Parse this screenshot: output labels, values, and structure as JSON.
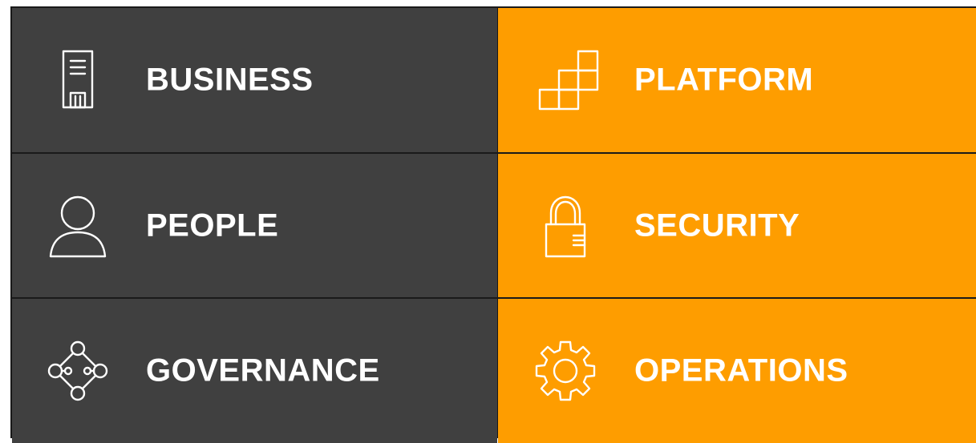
{
  "colors": {
    "dark_tile": "#404040",
    "accent_tile": "#fe9d00",
    "text": "#ffffff",
    "divider": "#1a1a1a"
  },
  "tiles": {
    "business": {
      "label": "BUSINESS",
      "icon": "building-icon",
      "color": "dark"
    },
    "platform": {
      "label": "PLATFORM",
      "icon": "blocks-icon",
      "color": "orange"
    },
    "people": {
      "label": "PEOPLE",
      "icon": "person-icon",
      "color": "dark"
    },
    "security": {
      "label": "SECURITY",
      "icon": "lock-icon",
      "color": "orange"
    },
    "governance": {
      "label": "GOVERNANCE",
      "icon": "network-icon",
      "color": "dark"
    },
    "operations": {
      "label": "OPERATIONS",
      "icon": "gear-icon",
      "color": "orange"
    }
  }
}
